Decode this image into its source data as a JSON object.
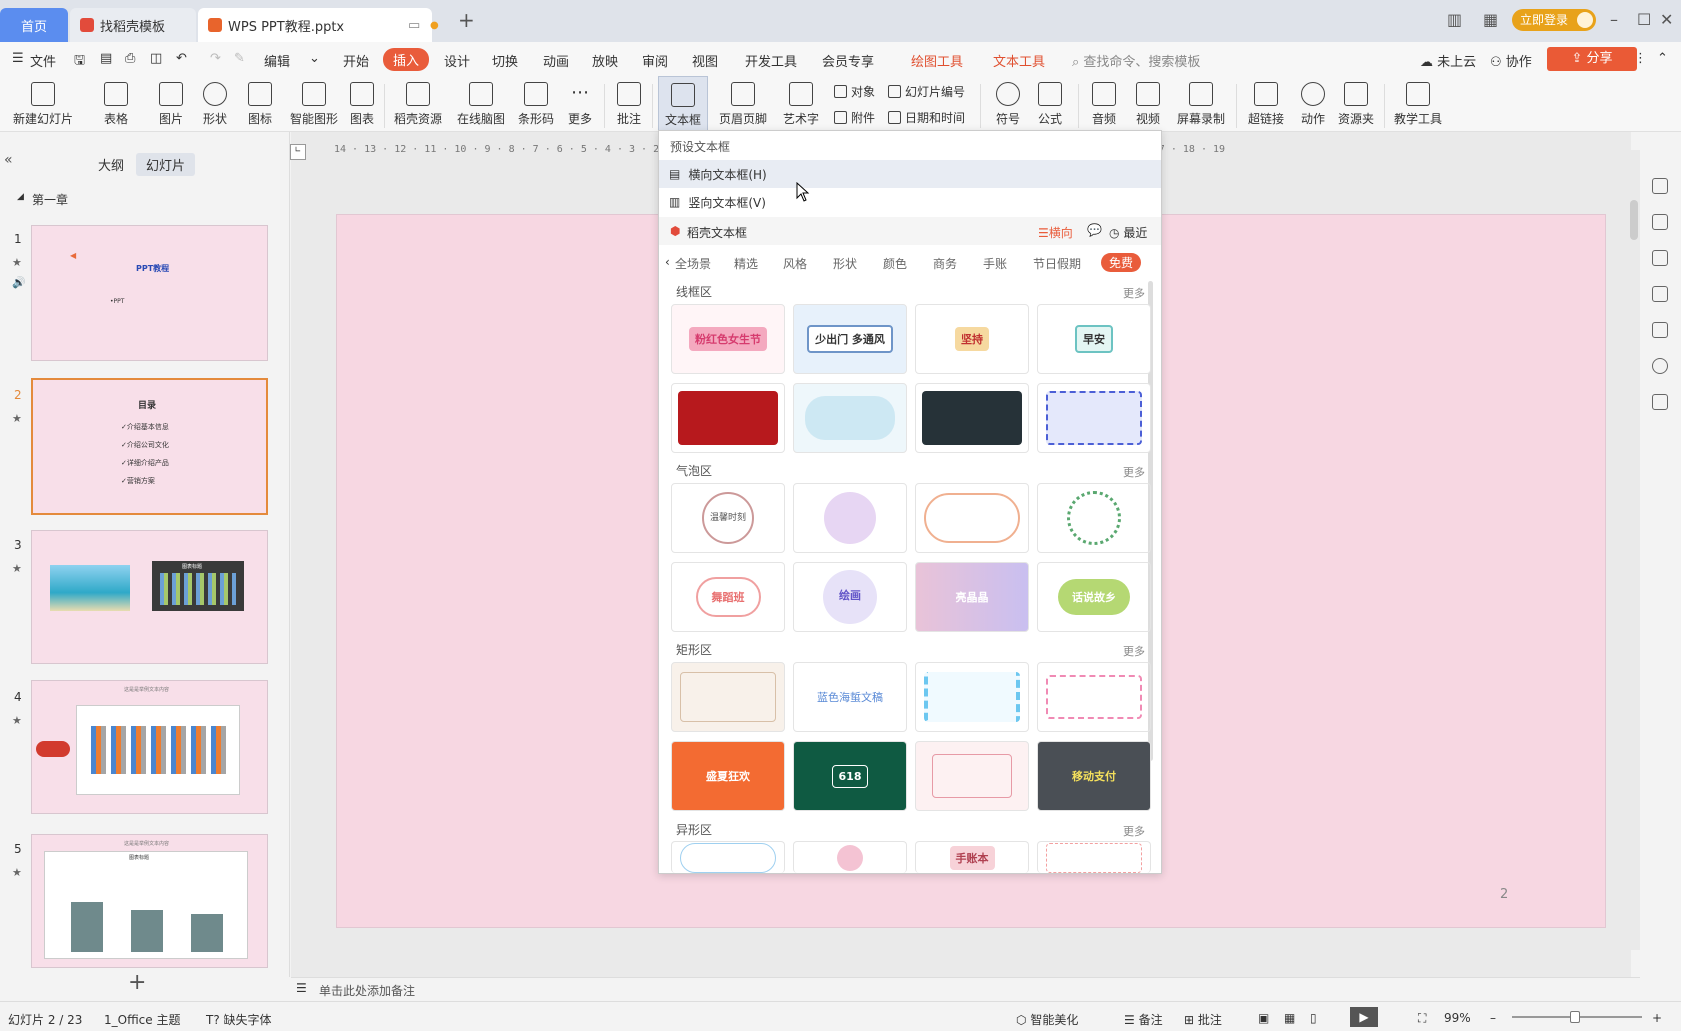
{
  "titlebar": {
    "tabs": [
      {
        "label": "首页"
      },
      {
        "label": "找稻壳模板"
      },
      {
        "label": "WPS PPT教程.pptx"
      }
    ],
    "login": "立即登录"
  },
  "menu": {
    "file": "文件",
    "edit": "编辑",
    "items": [
      "开始",
      "插入",
      "设计",
      "切换",
      "动画",
      "放映",
      "审阅",
      "视图",
      "开发工具",
      "会员专享",
      "绘图工具",
      "文本工具"
    ],
    "search_placeholder": "查找命令、搜索模板",
    "cloud": "未上云",
    "collab": "协作",
    "share": "分享"
  },
  "ribbon": {
    "new_slide": "新建幻灯片",
    "table": "表格",
    "picture": "图片",
    "shape": "形状",
    "icon": "图标",
    "smart": "智能图形",
    "chart": "图表",
    "daoke": "稻壳资源",
    "mindmap": "在线脑图",
    "barcode": "条形码",
    "more": "更多",
    "comment": "批注",
    "textbox": "文本框",
    "header_footer": "页眉页脚",
    "wordart": "艺术字",
    "object": "对象",
    "slide_number": "幻灯片编号",
    "attachment": "附件",
    "datetime": "日期和时间",
    "symbol": "符号",
    "formula": "公式",
    "audio": "音频",
    "video": "视频",
    "screen_rec": "屏幕录制",
    "hyperlink": "超链接",
    "action": "动作",
    "resource": "资源夹",
    "teaching": "教学工具"
  },
  "leftpanel": {
    "tab_outline": "大纲",
    "tab_slides": "幻灯片",
    "section": "第一章",
    "slides": [
      {
        "num": "1",
        "title": "PPT教程",
        "sub": "•PPT"
      },
      {
        "num": "2",
        "title": "目录",
        "items": [
          "✓介绍基本信息",
          "✓介绍公司文化",
          "✓详细介绍产品",
          "✓营销方案"
        ]
      },
      {
        "num": "3",
        "chart_label": "图表标题"
      },
      {
        "num": "4",
        "header": "这是是举例文本内容"
      },
      {
        "num": "5",
        "header": "这是是举例文本内容",
        "chart_label": "图表标题"
      }
    ],
    "add": "+"
  },
  "slide": {
    "page_number": "2"
  },
  "dropdown": {
    "preset": "预设文本框",
    "horizontal": "横向文本框(H)",
    "vertical": "竖向文本框(V)",
    "daoke": "稻壳文本框",
    "orient": "横向",
    "recent": "最近",
    "categories": [
      "全场景",
      "精选",
      "风格",
      "形状",
      "颜色",
      "商务",
      "手账",
      "节日假期",
      "免费"
    ],
    "sections": {
      "line": "线框区",
      "bubble": "气泡区",
      "rect": "矩形区",
      "special": "异形区"
    },
    "more": "更多",
    "cards": {
      "c1": "粉红色女生节",
      "c2": "少出门 多通风",
      "c3": "坚持",
      "c4": "早安",
      "c5": "",
      "c6": "",
      "c7": "",
      "c8": "",
      "c9": "温馨时刻",
      "c10": "",
      "c11": "",
      "c12": "",
      "c13": "舞蹈班",
      "c14": "绘画",
      "c15": "亮晶晶",
      "c16": "话说故乡",
      "c17": "",
      "c18": "蓝色海蜇文稿",
      "c19": "",
      "c20": "",
      "c21": "盛夏狂欢",
      "c22": "618",
      "c23": "",
      "c24": "移动支付",
      "c25": "",
      "c26": "",
      "c27": "手账本",
      "c28": ""
    }
  },
  "notes": {
    "placeholder": "单击此处添加备注"
  },
  "status": {
    "slide_info": "幻灯片 2 / 23",
    "theme": "1_Office 主题",
    "missing_font": "缺失字体",
    "beautify": "智能美化",
    "notes": "备注",
    "comment": "批注",
    "zoom": "99%"
  },
  "colors": {
    "accent": "#e95c3b",
    "home_tab": "#5b8def",
    "slide_bg": "#f7d7e2"
  }
}
